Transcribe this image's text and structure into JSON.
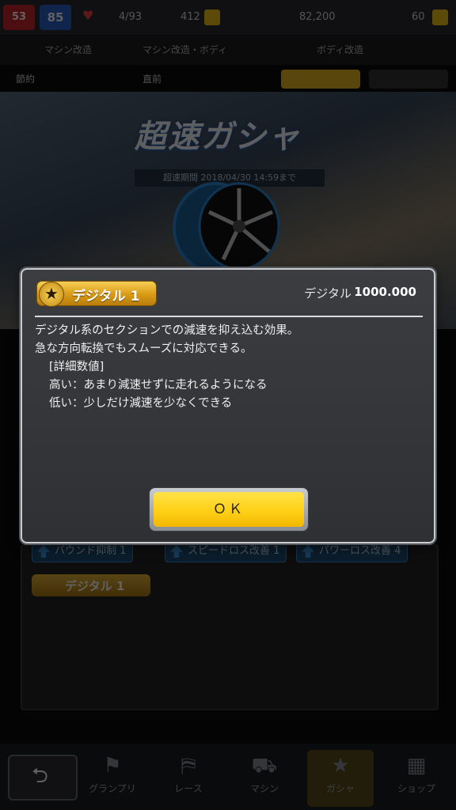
{
  "background": {
    "topbar": {
      "rank": "53",
      "level": "85",
      "stamina": "4/93",
      "value2": "412",
      "money": "82,200",
      "value4": "60"
    },
    "subrow": [
      "マシン改造",
      "マシン改造・ボディ",
      "ボディ改造"
    ],
    "statrow": [
      "節約",
      "直前"
    ],
    "banner": {
      "title": "超速ガシャ",
      "subtitle": "超速期間 2018/04/30 14:59まで"
    },
    "part_tags": [
      "バウンド抑制 1",
      "スピードロス改善 1",
      "パワーロス改善 4"
    ],
    "skill_tag": "デジタル 1",
    "nav": [
      "グランプリ",
      "レース",
      "マシン",
      "ガシャ",
      "ショップ"
    ]
  },
  "modal": {
    "skill_name": "デジタル 1",
    "param_label": "デジタル",
    "param_value": "1000.000",
    "description": [
      "デジタル系のセクションでの減速を抑え込む効果。",
      "急な方向転換でもスムーズに対応できる。",
      "[詳細数値]",
      "高い：あまり減速せずに走れるようになる",
      "低い：少しだけ減速を少なくできる"
    ],
    "ok_label": "ＯＫ"
  }
}
